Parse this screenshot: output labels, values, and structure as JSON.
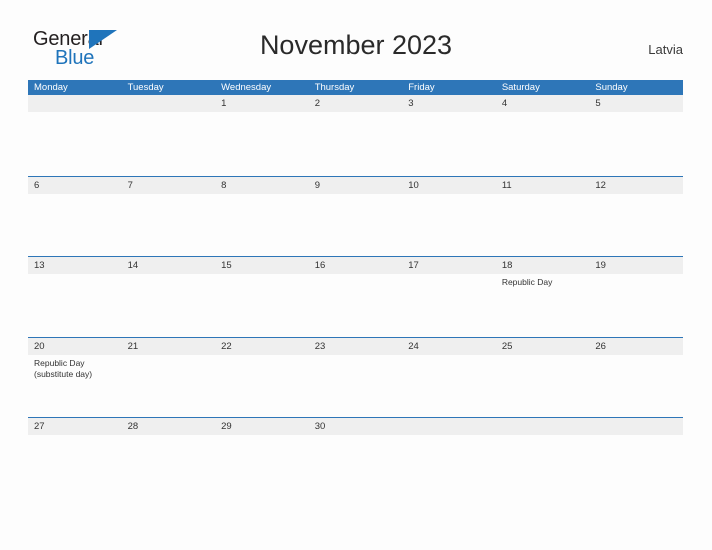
{
  "brand": {
    "name_part1": "General",
    "name_part2": "Blue",
    "color_dark": "#231f20",
    "color_blue": "#1f74bb",
    "flag_icon": "triangle-flag-icon"
  },
  "header": {
    "title": "November 2023",
    "region": "Latvia"
  },
  "theme": {
    "header_bar": "#2e76b8",
    "daynum_band": "#efefef",
    "page_background": "#fdfdfd",
    "rule_color": "#2e76b8"
  },
  "calendar": {
    "month": "November",
    "year": "2023",
    "weekday_headers": [
      "Monday",
      "Tuesday",
      "Wednesday",
      "Thursday",
      "Friday",
      "Saturday",
      "Sunday"
    ],
    "weeks": [
      {
        "days": [
          {
            "number": "",
            "events": []
          },
          {
            "number": "",
            "events": []
          },
          {
            "number": "1",
            "events": []
          },
          {
            "number": "2",
            "events": []
          },
          {
            "number": "3",
            "events": []
          },
          {
            "number": "4",
            "events": []
          },
          {
            "number": "5",
            "events": []
          }
        ]
      },
      {
        "days": [
          {
            "number": "6",
            "events": []
          },
          {
            "number": "7",
            "events": []
          },
          {
            "number": "8",
            "events": []
          },
          {
            "number": "9",
            "events": []
          },
          {
            "number": "10",
            "events": []
          },
          {
            "number": "11",
            "events": []
          },
          {
            "number": "12",
            "events": []
          }
        ]
      },
      {
        "days": [
          {
            "number": "13",
            "events": []
          },
          {
            "number": "14",
            "events": []
          },
          {
            "number": "15",
            "events": []
          },
          {
            "number": "16",
            "events": []
          },
          {
            "number": "17",
            "events": []
          },
          {
            "number": "18",
            "events": [
              "Republic Day"
            ]
          },
          {
            "number": "19",
            "events": []
          }
        ]
      },
      {
        "days": [
          {
            "number": "20",
            "events": [
              "Republic Day",
              "(substitute day)"
            ]
          },
          {
            "number": "21",
            "events": []
          },
          {
            "number": "22",
            "events": []
          },
          {
            "number": "23",
            "events": []
          },
          {
            "number": "24",
            "events": []
          },
          {
            "number": "25",
            "events": []
          },
          {
            "number": "26",
            "events": []
          }
        ]
      },
      {
        "days": [
          {
            "number": "27",
            "events": []
          },
          {
            "number": "28",
            "events": []
          },
          {
            "number": "29",
            "events": []
          },
          {
            "number": "30",
            "events": []
          },
          {
            "number": "",
            "events": []
          },
          {
            "number": "",
            "events": []
          },
          {
            "number": "",
            "events": []
          }
        ]
      }
    ]
  }
}
